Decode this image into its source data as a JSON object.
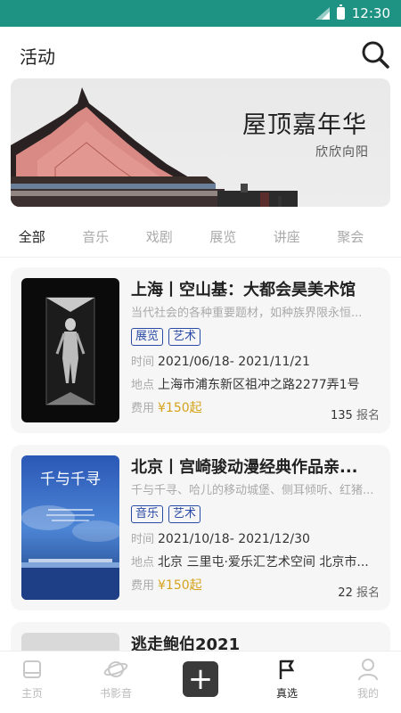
{
  "status_bar": {
    "time": "12:30"
  },
  "header": {
    "title": "活动"
  },
  "banner": {
    "title": "屋顶嘉年华",
    "subtitle": "欣欣向阳"
  },
  "tabs": [
    {
      "label": "全部",
      "active": true
    },
    {
      "label": "音乐",
      "active": false
    },
    {
      "label": "戏剧",
      "active": false
    },
    {
      "label": "展览",
      "active": false
    },
    {
      "label": "讲座",
      "active": false
    },
    {
      "label": "聚会",
      "active": false
    }
  ],
  "events": [
    {
      "title": "上海丨空山基：大都会昊美术馆",
      "description": "当代社会的各种重要题材，如种族界限永恒...",
      "tags": [
        "展览",
        "艺术"
      ],
      "time_label": "时间",
      "time": "2021/06/18- 2021/11/21",
      "location_label": "地点",
      "location": "上海市浦东新区祖冲之路2277弄1号",
      "fee_label": "费用",
      "fee": "¥150起",
      "count": "135",
      "count_unit": "报名"
    },
    {
      "title": "北京丨宫崎骏动漫经典作品亲...",
      "description": "千与千寻、哈儿的移动城堡、侧耳倾听、红猪...",
      "tags": [
        "音乐",
        "艺术"
      ],
      "time_label": "时间",
      "time": "2021/10/18- 2021/12/30",
      "location_label": "地点",
      "location": "北京 三里屯·爱乐汇艺术空间 北京市...",
      "fee_label": "费用",
      "fee": "¥150起",
      "count": "22",
      "count_unit": "报名",
      "poster_title": "千与千寻"
    },
    {
      "title": "逃走鲍伯2021"
    }
  ],
  "bottom_nav": {
    "home": "主页",
    "books": "书影音",
    "featured": "真选",
    "mine": "我的",
    "add": "+"
  },
  "colors": {
    "status_bar": "#1e9384",
    "tag": "#2a4ba5",
    "price": "#d4a21c"
  }
}
